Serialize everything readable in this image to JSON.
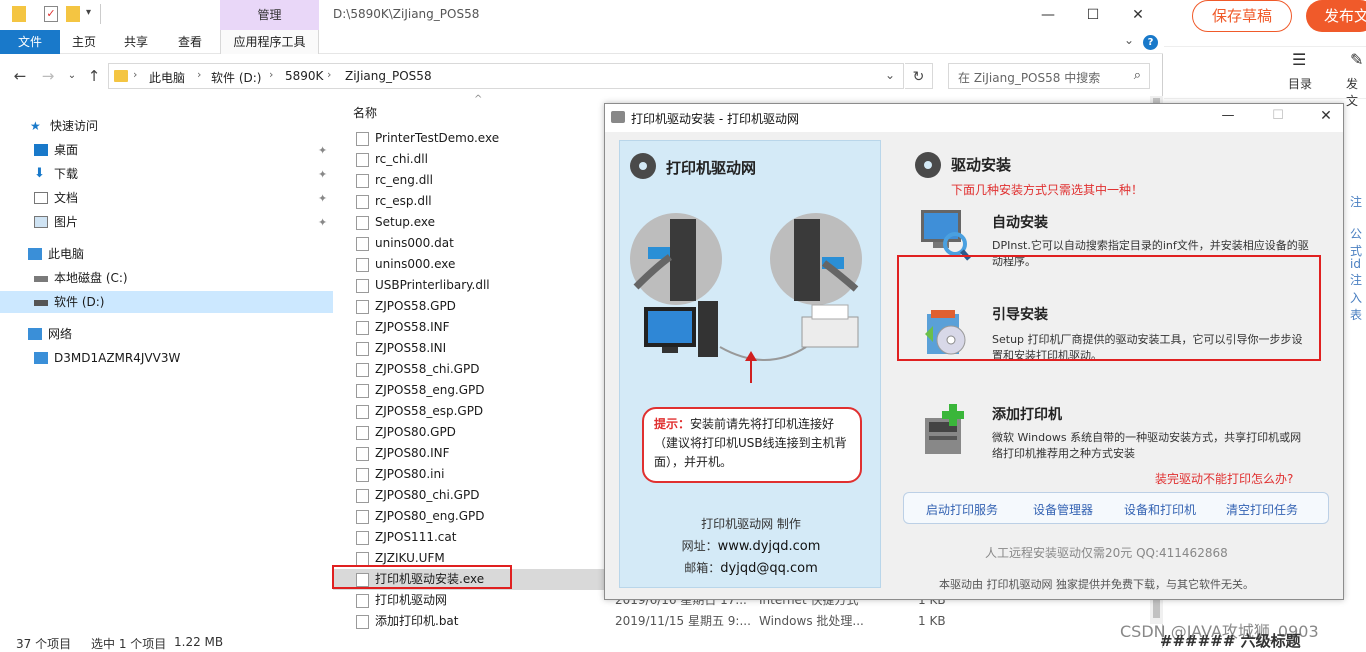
{
  "explorer": {
    "window_path": "D:\\5890K\\ZiJiang_POS58",
    "manage_tab": "管理",
    "ribbon_tabs": [
      "文件",
      "主页",
      "共享",
      "查看",
      "应用程序工具"
    ],
    "breadcrumbs": [
      "此电脑",
      "软件 (D:)",
      "5890K",
      "ZiJiang_POS58"
    ],
    "search_placeholder": "在 ZiJiang_POS58 中搜索",
    "nav": {
      "quick_access": "快速访问",
      "desktop": "桌面",
      "downloads": "下载",
      "documents": "文档",
      "pictures": "图片",
      "this_pc": "此电脑",
      "local_c": "本地磁盘 (C:)",
      "soft_d": "软件 (D:)",
      "network": "网络",
      "computer": "D3MD1AZMR4JVV3W"
    },
    "column_name": "名称",
    "files": [
      {
        "name": "PrinterTestDemo.exe",
        "date": "",
        "type": "",
        "size": ""
      },
      {
        "name": "rc_chi.dll",
        "date": "",
        "type": "",
        "size": ""
      },
      {
        "name": "rc_eng.dll",
        "date": "",
        "type": "",
        "size": ""
      },
      {
        "name": "rc_esp.dll",
        "date": "",
        "type": "",
        "size": ""
      },
      {
        "name": "Setup.exe",
        "date": "",
        "type": "",
        "size": ""
      },
      {
        "name": "unins000.dat",
        "date": "",
        "type": "",
        "size": ""
      },
      {
        "name": "unins000.exe",
        "date": "",
        "type": "",
        "size": ""
      },
      {
        "name": "USBPrinterlibary.dll",
        "date": "",
        "type": "",
        "size": ""
      },
      {
        "name": "ZJPOS58.GPD",
        "date": "",
        "type": "",
        "size": ""
      },
      {
        "name": "ZJPOS58.INF",
        "date": "",
        "type": "",
        "size": ""
      },
      {
        "name": "ZJPOS58.INI",
        "date": "",
        "type": "",
        "size": ""
      },
      {
        "name": "ZJPOS58_chi.GPD",
        "date": "",
        "type": "",
        "size": ""
      },
      {
        "name": "ZJPOS58_eng.GPD",
        "date": "",
        "type": "",
        "size": ""
      },
      {
        "name": "ZJPOS58_esp.GPD",
        "date": "",
        "type": "",
        "size": ""
      },
      {
        "name": "ZJPOS80.GPD",
        "date": "",
        "type": "",
        "size": ""
      },
      {
        "name": "ZJPOS80.INF",
        "date": "",
        "type": "",
        "size": ""
      },
      {
        "name": "ZJPOS80.ini",
        "date": "",
        "type": "",
        "size": ""
      },
      {
        "name": "ZJPOS80_chi.GPD",
        "date": "",
        "type": "",
        "size": ""
      },
      {
        "name": "ZJPOS80_eng.GPD",
        "date": "",
        "type": "",
        "size": ""
      },
      {
        "name": "ZJPOS111.cat",
        "date": "",
        "type": "",
        "size": ""
      },
      {
        "name": "ZJZIKU.UFM",
        "date": "",
        "type": "",
        "size": ""
      },
      {
        "name": "打印机驱动安装.exe",
        "date": "",
        "type": "",
        "size": ""
      },
      {
        "name": "打印机驱动网",
        "date": "2019/6/16 星期日 17...",
        "type": "Internet 快捷方式",
        "size": "1 KB"
      },
      {
        "name": "添加打印机.bat",
        "date": "2019/11/15 星期五 9:...",
        "type": "Windows 批处理...",
        "size": "1 KB"
      }
    ],
    "status": {
      "count": "37 个项目",
      "selected": "选中 1 个项目",
      "size": "1.22 MB"
    }
  },
  "editor": {
    "save_draft": "保存草稿",
    "publish": "发布文",
    "toc_label": "目录",
    "publish_short": "发文",
    "edge_bits": [
      "注",
      "公式",
      "id注",
      "入表"
    ]
  },
  "dialog": {
    "title": "打印机驱动安装 - 打印机驱动网",
    "left_title": "打印机驱动网",
    "tip_label": "提示：",
    "tip_text": "安装前请先将打印机连接好（建议将打印机USB线连接到主机背面），并开机。",
    "credit": "打印机驱动网  制作",
    "site_label": "网址：",
    "site": "www.dyjqd.com",
    "mail_label": "邮箱：",
    "mail": "dyjqd@qq.com",
    "right_title": "驱动安装",
    "right_sub": "下面几种安装方式只需选其中一种！",
    "options": [
      {
        "title": "自动安装",
        "desc": "DPInst.它可以自动搜索指定目录的inf文件，并安装相应设备的驱动程序。"
      },
      {
        "title": "引导安装",
        "desc": "Setup 打印机厂商提供的驱动安装工具，它可以引导你一步步设置和安装打印机驱动。"
      },
      {
        "title": "添加打印机",
        "desc": "微软 Windows 系统自带的一种驱动安装方式，共享打印机或网络打印机推荐用之种方式安装"
      }
    ],
    "help_link": "装完驱动不能打印怎么办?",
    "services": [
      "启动打印服务",
      "设备管理器",
      "设备和打印机",
      "清空打印任务"
    ],
    "price": "人工远程安装驱动仅需20元  QQ:411462868",
    "notice": "本驱动由 打印机驱动网 独家提供并免费下载，与其它软件无关。"
  },
  "watermark": "CSDN @JAVA攻城狮_0903",
  "watermark2": "###### 六级标题"
}
